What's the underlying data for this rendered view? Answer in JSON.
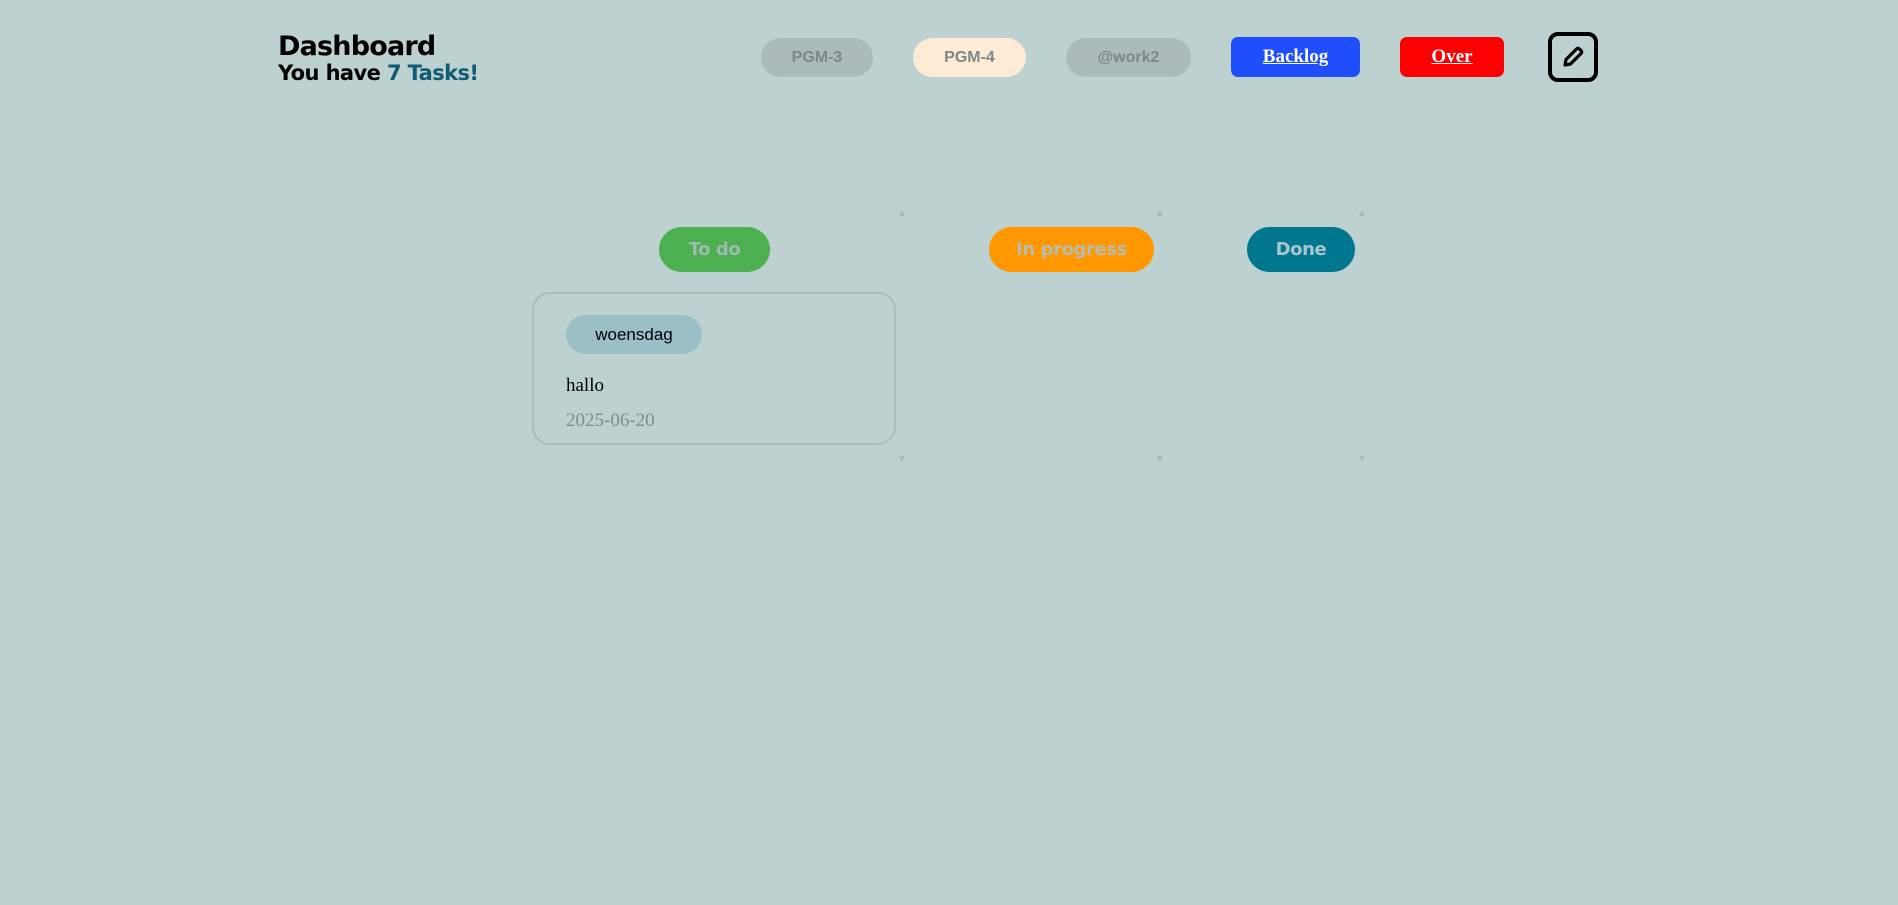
{
  "header": {
    "title": "Dashboard",
    "subtitle_prefix": "You have ",
    "subtitle_count": "7 Tasks!"
  },
  "filters": [
    {
      "label": "PGM-3"
    },
    {
      "label": "PGM-4"
    },
    {
      "label": "@work2"
    }
  ],
  "nav": {
    "backlog_label": "Backlog",
    "over_label": "Over",
    "edit_icon": "pencil-icon"
  },
  "columns": [
    {
      "label": "To do"
    },
    {
      "label": "In progress"
    },
    {
      "label": "Done"
    }
  ],
  "tasks": [
    {
      "tag": "woensdag",
      "text": "hallo",
      "date": "2025-06-20"
    }
  ],
  "colors": {
    "background": "#bdd1d0",
    "todo": "#4caf50",
    "in_progress": "#ff9800",
    "done": "#00778f",
    "backlog": "#1f4ffc",
    "over": "#fb0000",
    "selected_filter": "#fdebd6"
  }
}
